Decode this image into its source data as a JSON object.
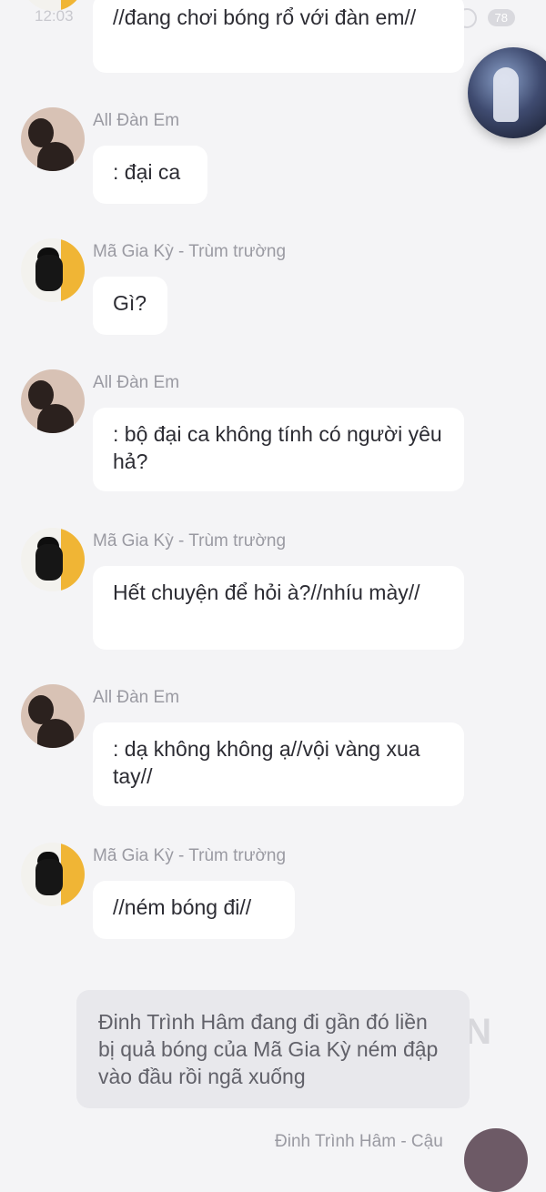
{
  "status_bar": {
    "time": "12:03",
    "battery": "78"
  },
  "messages": [
    {
      "speaker": "",
      "text": "//đang chơi bóng rổ với đàn em//"
    },
    {
      "speaker": "All Đàn Em",
      "text": ": đại ca",
      "avatar": "silhouette-avatar"
    },
    {
      "speaker": "Mã Gia Kỳ - Trùm trường",
      "text": "Gì?",
      "avatar": "photo-avatar"
    },
    {
      "speaker": "All Đàn Em",
      "text": ": bộ đại ca không tính có người yêu hả?",
      "avatar": "silhouette-avatar"
    },
    {
      "speaker": "Mã Gia Kỳ - Trùm trường",
      "text": "Hết chuyện để hỏi à?//nhíu mày//",
      "avatar": "photo-avatar"
    },
    {
      "speaker": "All Đàn Em",
      "text": ": dạ không không ạ//vội vàng xua tay//",
      "avatar": "silhouette-avatar"
    },
    {
      "speaker": "Mã Gia Kỳ - Trùm trường",
      "text": "//ném bóng đi//",
      "avatar": "photo-avatar"
    }
  ],
  "narration": "Đinh Trình Hâm đang đi gần đó liền bị quả bóng của Mã Gia Kỳ ném đập vào đầu rồi ngã xuống",
  "watermark": "ON",
  "next_speaker": "Đinh Trình Hâm - Cậu"
}
